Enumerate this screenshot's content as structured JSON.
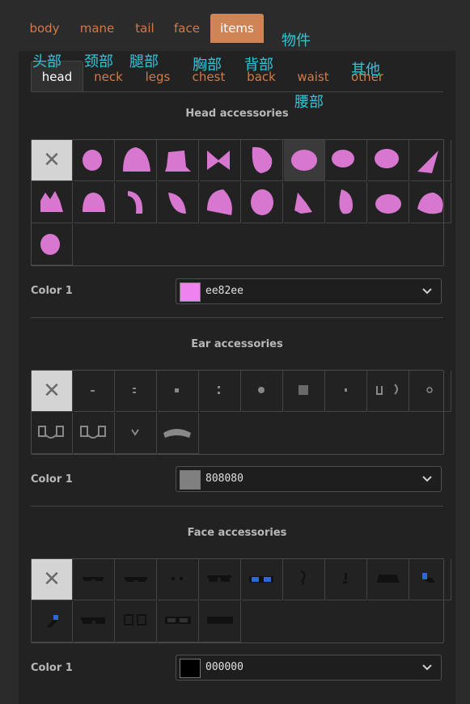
{
  "top_tabs": [
    "body",
    "mane",
    "tail",
    "face",
    "items"
  ],
  "sub_tabs": [
    "head",
    "neck",
    "legs",
    "chest",
    "back",
    "waist",
    "other"
  ],
  "annotations": {
    "items": "物件",
    "head": "头部",
    "neck": "颈部",
    "legs": "腿部",
    "chest": "胸部",
    "back": "背部",
    "waist": "腰部",
    "other": "其他"
  },
  "sections": [
    {
      "title": "Head accessories",
      "color_label": "Color 1",
      "color_hex": "ee82ee",
      "swatch_color": "#ee82ee",
      "item_count": 21
    },
    {
      "title": "Ear accessories",
      "color_label": "Color 1",
      "color_hex": "808080",
      "swatch_color": "#808080",
      "item_count": 14
    },
    {
      "title": "Face accessories",
      "color_label": "Color 1",
      "color_hex": "000000",
      "swatch_color": "#000000",
      "item_count": 15
    }
  ],
  "icons": {
    "none": "x-icon",
    "dropdown": "chevron-down-icon"
  },
  "colors": {
    "accent": "#cf8455",
    "tab_text": "#d07a4c",
    "annotation": "#2fc6d8",
    "head_item": "#d777d0",
    "ear_item": "#888888",
    "face_item": "#111111",
    "face_lens_blue": "#2a6ad8"
  }
}
